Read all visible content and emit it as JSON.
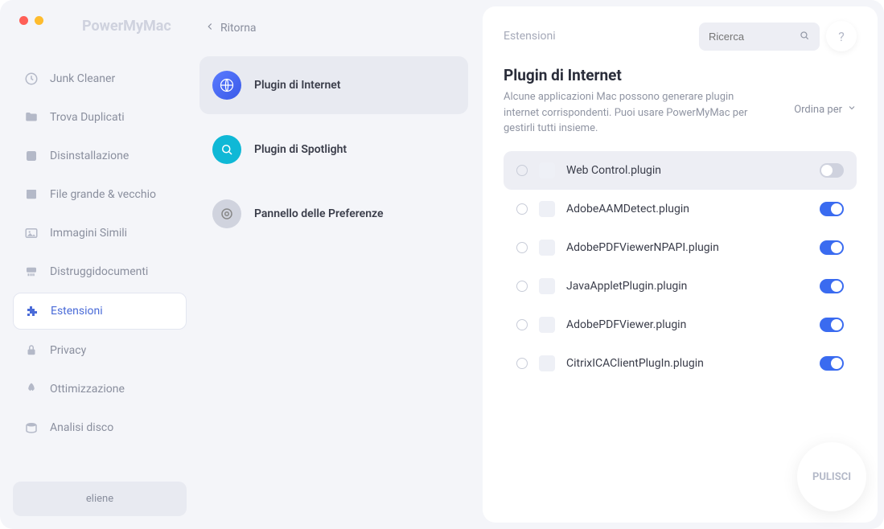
{
  "brand": "PowerMyMac",
  "back_label": "Ritorna",
  "breadcrumb": "Estensioni",
  "search": {
    "placeholder": "Ricerca"
  },
  "sort_label": "Ordina per",
  "clean_label": "PULISCI",
  "user_name": "eliene",
  "sidebar": {
    "items": [
      {
        "label": "Junk Cleaner"
      },
      {
        "label": "Trova Duplicati"
      },
      {
        "label": "Disinstallazione"
      },
      {
        "label": "File grande & vecchio"
      },
      {
        "label": "Immagini Simili"
      },
      {
        "label": "Distruggidocumenti"
      },
      {
        "label": "Estensioni"
      },
      {
        "label": "Privacy"
      },
      {
        "label": "Ottimizzazione"
      },
      {
        "label": "Analisi disco"
      }
    ]
  },
  "categories": [
    {
      "label": "Plugin di Internet"
    },
    {
      "label": "Plugin di Spotlight"
    },
    {
      "label": "Pannello delle Preferenze"
    }
  ],
  "page": {
    "title": "Plugin di Internet",
    "desc": "Alcune applicazioni Mac possono generare plugin internet corrispondenti. Puoi usare PowerMyMac per gestirli tutti insieme."
  },
  "plugins": [
    {
      "name": "Web Control.plugin",
      "enabled": false,
      "highlight": true
    },
    {
      "name": "AdobeAAMDetect.plugin",
      "enabled": true,
      "highlight": false
    },
    {
      "name": "AdobePDFViewerNPAPI.plugin",
      "enabled": true,
      "highlight": false
    },
    {
      "name": "JavaAppletPlugin.plugin",
      "enabled": true,
      "highlight": false
    },
    {
      "name": "AdobePDFViewer.plugin",
      "enabled": true,
      "highlight": false
    },
    {
      "name": "CitrixICAClientPlugIn.plugin",
      "enabled": true,
      "highlight": false
    }
  ]
}
